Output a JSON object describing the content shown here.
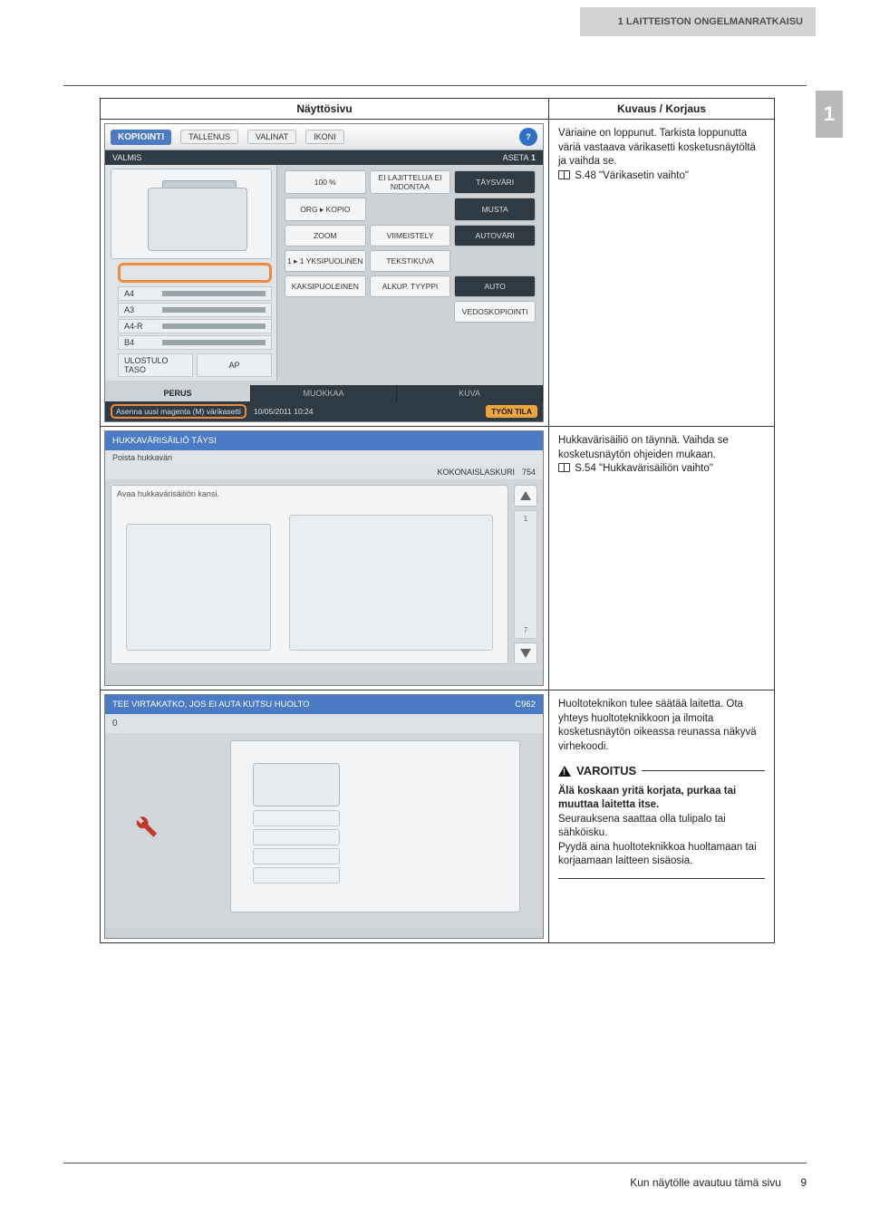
{
  "header": {
    "title": "1 LAITTEISTON ONGELMANRATKAISU"
  },
  "chapter": "1",
  "footer": {
    "text": "Kun näytölle avautuu tämä sivu",
    "page": "9"
  },
  "table": {
    "col_screenshot": "Näyttösivu",
    "col_desc": "Kuvaus / Korjaus"
  },
  "row1": {
    "desc": "Väriaine on loppunut. Tarkista loppunutta väriä vastaava värikasetti kosketusnäytöltä ja vaihda se.",
    "ref": "S.48 \"Värikasetin vaihto\"",
    "ui": {
      "tab_copy": "KOPIOINTI",
      "chips": [
        "TALLENUS",
        "VALINAT",
        "IKONI"
      ],
      "status_ready": "VALMIS",
      "aseta": "ASETA",
      "counter": "1",
      "paper": [
        "A4",
        "A3",
        "A4-R",
        "B4"
      ],
      "btn_auto": "AUTO",
      "btn_out": "ULOSTULO TASO",
      "btn_ap": "AP",
      "tiles": [
        "100 %",
        "ORG ▸ KOPIO",
        "EI LAJITTELUA EI NIDONTAA",
        "TÄYSVÄRI",
        "MUSTA",
        "AUTOVÄRI"
      ],
      "tiles2": [
        "ZOOM",
        "VIIMEISTELY"
      ],
      "tiles3": [
        "1 ▸ 1 YKSIPUOLINEN",
        "TEKSTIKUVA"
      ],
      "tiles4": [
        "KAKSIPUOLEINEN",
        "ALKUP. TYYPPI",
        "AUTO"
      ],
      "tiles5": "VEDOSKOPIOINTI",
      "bottom_tabs": [
        "PERUS",
        "MUOKKAA",
        "KUVA"
      ],
      "status_msg": "Asenna uusi magenta (M) värikasetti",
      "status_time": "10/05/2011 10:24",
      "status_btn": "TYÖN TILA"
    }
  },
  "row2": {
    "desc": "Hukkavärisäiliö on täynnä. Vaihda se kosketusnäytön ohjeiden mukaan.",
    "ref": "S.54 \"Hukkavärisäiliön vaihto\"",
    "ui": {
      "title": "HUKKAVÄRISÄILIÖ TÄYSI",
      "sub": "Poista hukkaväri",
      "counter_label": "KOKONAISLASKURI",
      "counter_value": "754",
      "step": "Avaa hukkavärisäiliön kansi.",
      "scroll_pos": "1",
      "scroll_total": "7"
    }
  },
  "row3": {
    "p1": "Huoltoteknikon tulee säätää laitetta. Ota yhteys huoltoteknikkoon ja ilmoita kosketusnäytön oikeassa reunassa näkyvä virhekoodi.",
    "warn_label": "VAROITUS",
    "p2_bold": "Älä koskaan yritä korjata, purkaa tai muuttaa laitetta itse.",
    "p2_rest": "Seurauksena saattaa olla tulipalo tai sähköisku.\nPyydä aina huoltoteknikkoa huoltamaan tai korjaamaan laitteen sisäosia.",
    "ui": {
      "title": "TEE VIRTAKATKO, JOS EI AUTA KUTSU HUOLTO",
      "code": "C962",
      "sub": "0"
    }
  }
}
